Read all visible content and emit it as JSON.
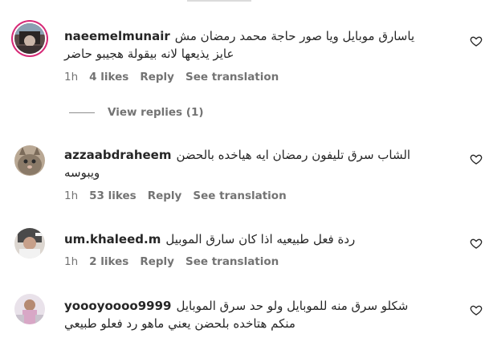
{
  "comments": [
    {
      "username": "naeemelmunair",
      "text_line1": "ياسارق موبايل ويا صور حاجة محمد رمضان مش",
      "text_line2": "عايز يذيعها لانه بيقولة هجيبو حاضر",
      "time": "1h",
      "likes": "4 likes",
      "reply": "Reply",
      "translate": "See translation",
      "avatar_icon": "user-avatar-icon",
      "has_story_ring": true
    },
    {
      "username": "azzaabdraheem",
      "text_line1": "الشاب سرق تليفون رمضان ايه هياخده بالحضن",
      "text_line2": "ويبوسه",
      "time": "1h",
      "likes": "53 likes",
      "reply": "Reply",
      "translate": "See translation",
      "avatar_icon": "cat-avatar-icon"
    },
    {
      "username": "um.khaleed.m",
      "text_line1": "ردة فعل طبيعيه اذا كان سارق الموبيل",
      "time": "1h",
      "likes": "2 likes",
      "reply": "Reply",
      "translate": "See translation",
      "avatar_icon": "person-avatar-icon"
    },
    {
      "username": "yoooyoooo9999",
      "text_line1": "شكلو سرق منه للموبايل ولو حد سرق الموبايل",
      "text_line2": "منكم هتاخده بلحضن يعني ماهو رد فعلو طبيعي",
      "avatar_icon": "person-avatar-icon"
    }
  ],
  "view_replies": "View replies (1)",
  "colors": {
    "text": "#262626",
    "meta": "#737373",
    "ring": "#d62976"
  }
}
